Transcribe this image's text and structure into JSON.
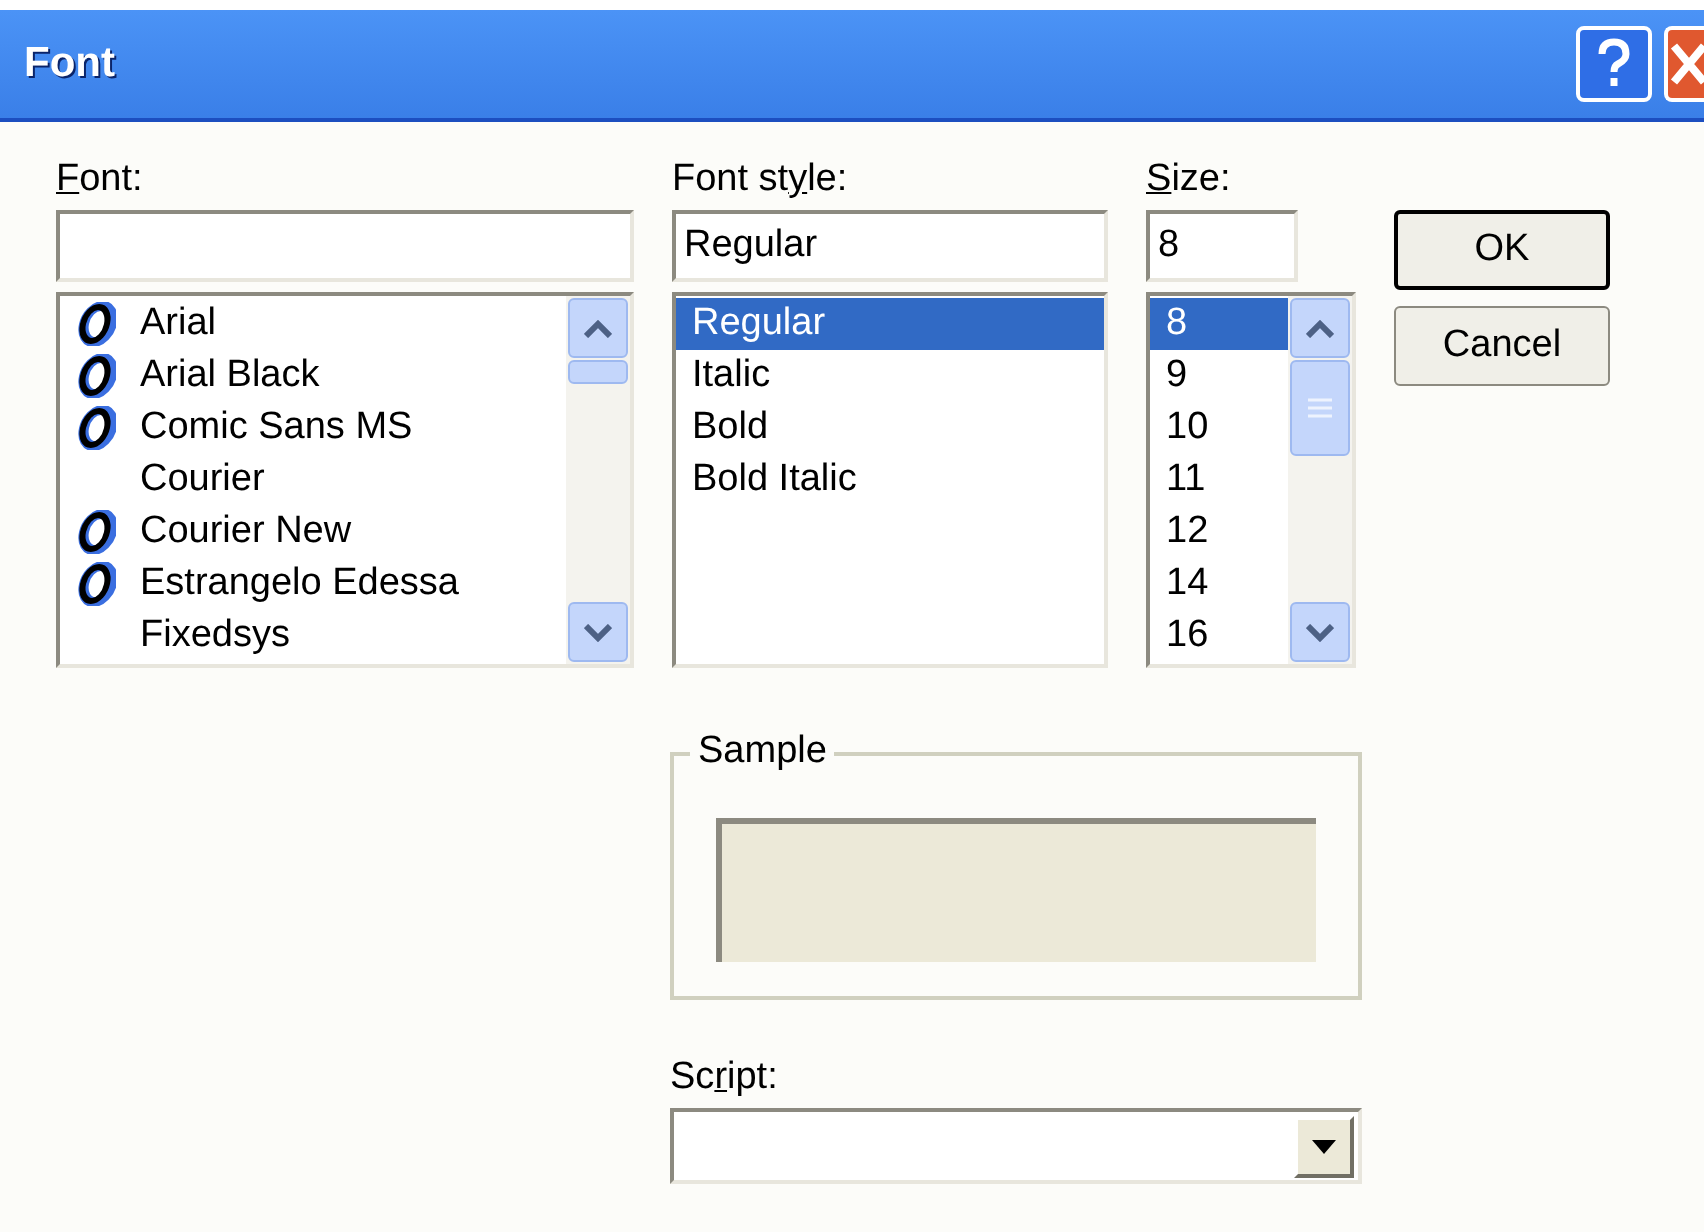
{
  "window": {
    "title": "Font"
  },
  "font": {
    "label": {
      "key": "F",
      "after": "ont:"
    },
    "items": [
      {
        "name": "Arial",
        "opentype": true,
        "selected": false
      },
      {
        "name": "Arial Black",
        "opentype": true,
        "selected": false
      },
      {
        "name": "Comic Sans MS",
        "opentype": true,
        "selected": false
      },
      {
        "name": "Courier",
        "opentype": false,
        "selected": false
      },
      {
        "name": "Courier New",
        "opentype": true,
        "selected": false
      },
      {
        "name": "Estrangelo Edessa",
        "opentype": true,
        "selected": false
      },
      {
        "name": "Fixedsys",
        "opentype": false,
        "selected": false
      }
    ]
  },
  "font_style": {
    "label": {
      "before": "Font st",
      "key": "y",
      "after": "le:"
    },
    "value": "Regular",
    "items": [
      {
        "name": "Regular",
        "selected": true
      },
      {
        "name": "Italic",
        "selected": false
      },
      {
        "name": "Bold",
        "selected": false
      },
      {
        "name": "Bold Italic",
        "selected": false
      }
    ]
  },
  "size": {
    "label": {
      "key": "S",
      "after": "ize:"
    },
    "value": "8",
    "items": [
      {
        "name": "8",
        "selected": true
      },
      {
        "name": "9",
        "selected": false
      },
      {
        "name": "10",
        "selected": false
      },
      {
        "name": "11",
        "selected": false
      },
      {
        "name": "12",
        "selected": false
      },
      {
        "name": "14",
        "selected": false
      },
      {
        "name": "16",
        "selected": false
      }
    ]
  },
  "buttons": [
    "OK",
    "Cancel"
  ],
  "sample": {
    "label": "Sample"
  },
  "script": {
    "label": {
      "before": "Sc",
      "key": "r",
      "after": "ipt:"
    }
  }
}
